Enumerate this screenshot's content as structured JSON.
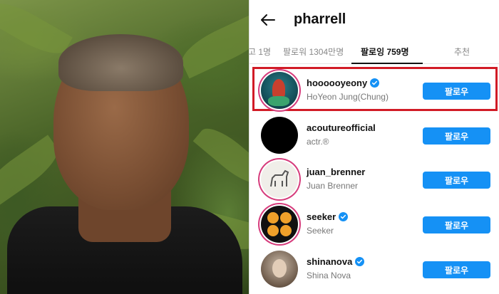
{
  "header": {
    "username": "pharrell"
  },
  "tabs": [
    {
      "label": "고 1명"
    },
    {
      "label": "팔로워 1304만명"
    },
    {
      "label": "팔로잉 759명"
    },
    {
      "label": "추천"
    }
  ],
  "following": [
    {
      "username": "hoooooyeony",
      "full_name": "HoYeon Jung(Chung)",
      "verified": true,
      "highlighted": true,
      "button": "팔로우"
    },
    {
      "username": "acoutureofficial",
      "full_name": "actr.®",
      "verified": false,
      "highlighted": false,
      "button": "팔로우"
    },
    {
      "username": "juan_brenner",
      "full_name": "Juan Brenner",
      "verified": false,
      "highlighted": false,
      "button": "팔로우"
    },
    {
      "username": "seeker",
      "full_name": "Seeker",
      "verified": true,
      "highlighted": false,
      "button": "팔로우"
    },
    {
      "username": "shinanova",
      "full_name": "Shina Nova",
      "verified": true,
      "highlighted": false,
      "button": "팔로우"
    }
  ],
  "colors": {
    "follow_button": "#1591f5",
    "verified_badge": "#1591f5",
    "highlight_box": "#d11b26",
    "story_ring": "#d63c7c"
  },
  "icons": {
    "back": "arrow-left-icon",
    "verified": "verified-badge-icon"
  }
}
